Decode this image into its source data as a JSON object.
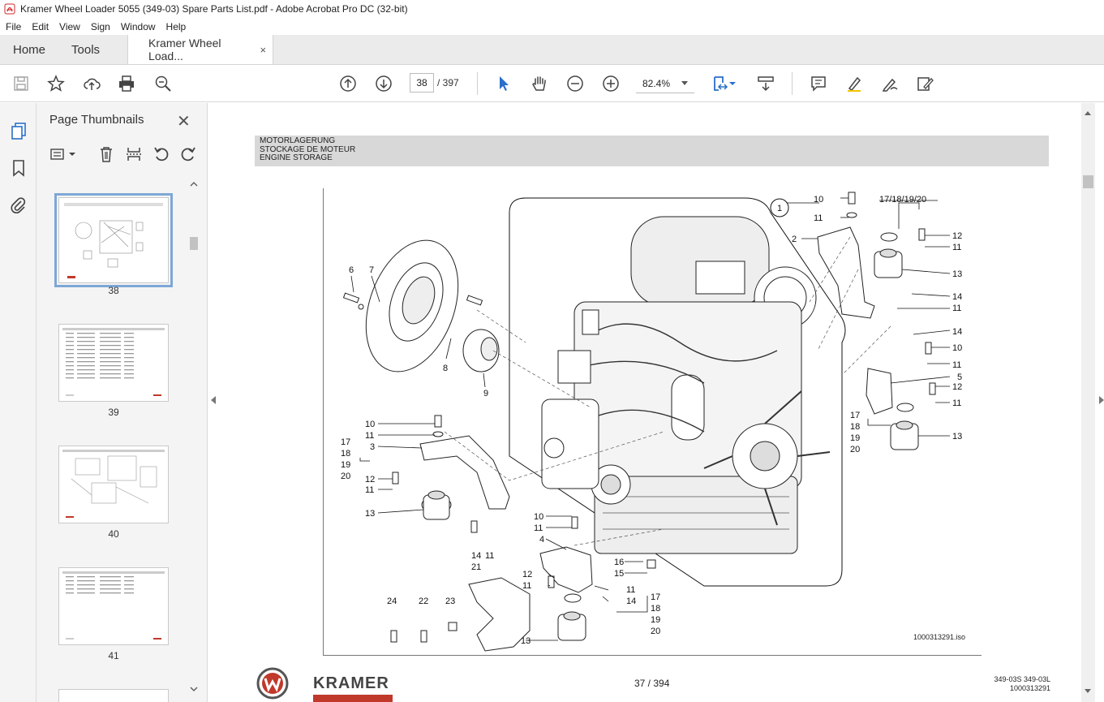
{
  "window": {
    "title": "Kramer Wheel Loader 5055 (349-03) Spare Parts List.pdf - Adobe Acrobat Pro DC (32-bit)"
  },
  "menu": [
    "File",
    "Edit",
    "View",
    "Sign",
    "Window",
    "Help"
  ],
  "tabs": {
    "home": "Home",
    "tools": "Tools",
    "document": "Kramer Wheel Load...",
    "close_glyph": "×"
  },
  "toolbar": {
    "current_page": "38",
    "page_total": "/  397",
    "zoom": "82.4%"
  },
  "thumbnails_panel": {
    "title": "Page Thumbnails",
    "close_glyph": "✕",
    "pages": [
      {
        "label": "38",
        "selected": true
      },
      {
        "label": "39",
        "selected": false
      },
      {
        "label": "40",
        "selected": false
      },
      {
        "label": "41",
        "selected": false
      }
    ]
  },
  "document": {
    "heading": [
      "MOTORLAGERUNG",
      "STOCKAGE DE MOTEUR",
      "ENGINE STORAGE"
    ],
    "header_group": "17/18/19/20",
    "callouts": {
      "c1": "1",
      "c2": "2",
      "c3": "3",
      "c4": "4",
      "c5": "5",
      "c6": "6",
      "c7": "7",
      "c8": "8",
      "c9": "9",
      "c10a": "10",
      "c10b": "10",
      "c10c": "10",
      "c10d": "10",
      "c11a": "11",
      "c11b": "11",
      "c11c": "11",
      "c11d": "11",
      "c11e": "11",
      "c11f": "11",
      "c11g": "11",
      "c11h": "11",
      "c11i": "11",
      "c11j": "11",
      "c12a": "12",
      "c12b": "12",
      "c12c": "12",
      "c12d": "12",
      "c13a": "13",
      "c13b": "13",
      "c13c": "13",
      "c13d": "13",
      "c14a": "14",
      "c14b": "14",
      "c14c": "14",
      "c14d": "14",
      "c15": "15",
      "c16": "16",
      "c17a": "17",
      "c17b": "17",
      "c17c": "17",
      "c18a": "18",
      "c18b": "18",
      "c18c": "18",
      "c19a": "19",
      "c19b": "19",
      "c19c": "19",
      "c20a": "20",
      "c20b": "20",
      "c20c": "20",
      "c21": "21",
      "c22": "22",
      "c23": "23",
      "c24": "24"
    },
    "image_id": "1000313291.iso",
    "page_number": "37 / 394",
    "footer_ref_line1": "349-03S   349-03L",
    "footer_ref_line2": "1000313291",
    "brand": "KRAMER"
  },
  "colors": {
    "accent_blue": "#2a6fc9",
    "brand_red": "#c0392b",
    "heading_band": "#d8d8d8"
  }
}
